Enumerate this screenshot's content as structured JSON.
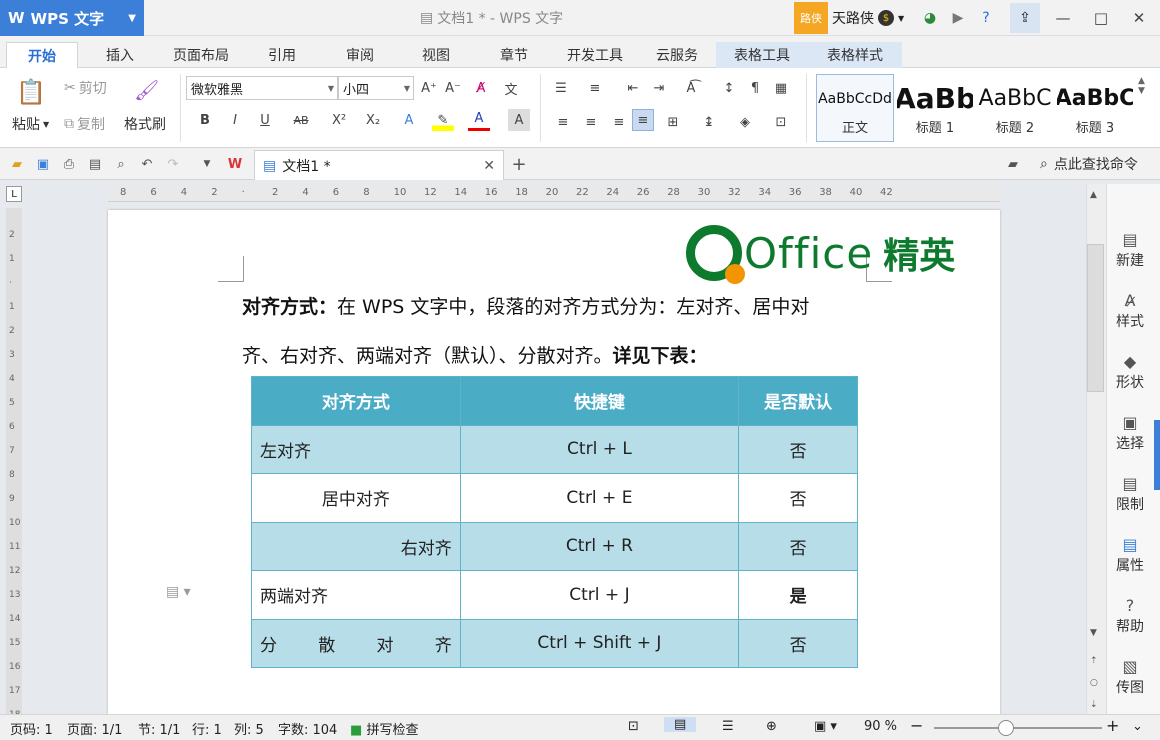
{
  "app": {
    "name": "WPS 文字",
    "window_title": "文档1 * - WPS 文字",
    "user_badge": "路侠",
    "user_name": "天路侠"
  },
  "tabs": [
    "开始",
    "插入",
    "页面布局",
    "引用",
    "审阅",
    "视图",
    "章节",
    "开发工具",
    "云服务",
    "表格工具",
    "表格样式"
  ],
  "ribbon": {
    "paste": "粘贴",
    "cut": "剪切",
    "copy": "复制",
    "format_painter": "格式刷",
    "font_name": "微软雅黑",
    "font_size": "小四",
    "styles": [
      {
        "preview": "AaBbCcDd",
        "label": "正文"
      },
      {
        "preview": "AaBb",
        "label": "标题 1"
      },
      {
        "preview": "AaBbC",
        "label": "标题 2"
      },
      {
        "preview": "AaBbC",
        "label": "标题 3"
      }
    ]
  },
  "document_tab": {
    "name": "文档1 *"
  },
  "find_command": "点此查找命令",
  "ruler": {
    "ticks": [
      "8",
      "6",
      "4",
      "2",
      "",
      "2",
      "4",
      "6",
      "8",
      "10",
      "12",
      "14",
      "16",
      "18",
      "20",
      "22",
      "24",
      "26",
      "28",
      "30",
      "32",
      "34",
      "36",
      "38",
      "40",
      "42"
    ]
  },
  "vruler_ticks": [
    "2",
    "1",
    "",
    "1",
    "2",
    "3",
    "4",
    "5",
    "6",
    "7",
    "8",
    "9",
    "10",
    "11",
    "12",
    "13",
    "14",
    "15",
    "16",
    "17",
    "18"
  ],
  "logo": {
    "mark": "Office",
    "cn": "精英"
  },
  "document": {
    "line1_bold": "对齐方式：",
    "line1_rest": "在 WPS  文字中，段落的对齐方式分为：左对齐、居中对",
    "line2_rest": "齐、右对齐、两端对齐（默认）、分散对齐。",
    "line2_bold": "详见下表："
  },
  "table": {
    "headers": [
      "对齐方式",
      "快捷键",
      "是否默认"
    ],
    "rows": [
      {
        "name": "左对齐",
        "key": "Ctrl + L",
        "default": "否"
      },
      {
        "name": "居中对齐",
        "key": "Ctrl + E",
        "default": "否"
      },
      {
        "name": "右对齐",
        "key": "Ctrl + R",
        "default": "否"
      },
      {
        "name": "两端对齐",
        "key": "Ctrl + J",
        "default": "是"
      },
      {
        "name_chars": [
          "分",
          "散",
          "对",
          "齐"
        ],
        "key": "Ctrl + Shift + J",
        "default": "否"
      }
    ]
  },
  "side_panel": [
    "新建",
    "样式",
    "形状",
    "选择",
    "限制",
    "属性",
    "帮助",
    "传图"
  ],
  "status": {
    "page_no": "页码: 1",
    "pages": "页面: 1/1",
    "section": "节: 1/1",
    "row": "行: 1",
    "col": "列: 5",
    "words": "字数: 104",
    "spell": "拼写检查",
    "zoom": "90 %"
  },
  "colors": {
    "accent": "#3b7fd8",
    "table_header": "#4bacc6",
    "table_band": "#b6dde8",
    "logo_green": "#0d7a2e",
    "logo_orange": "#f39400"
  }
}
